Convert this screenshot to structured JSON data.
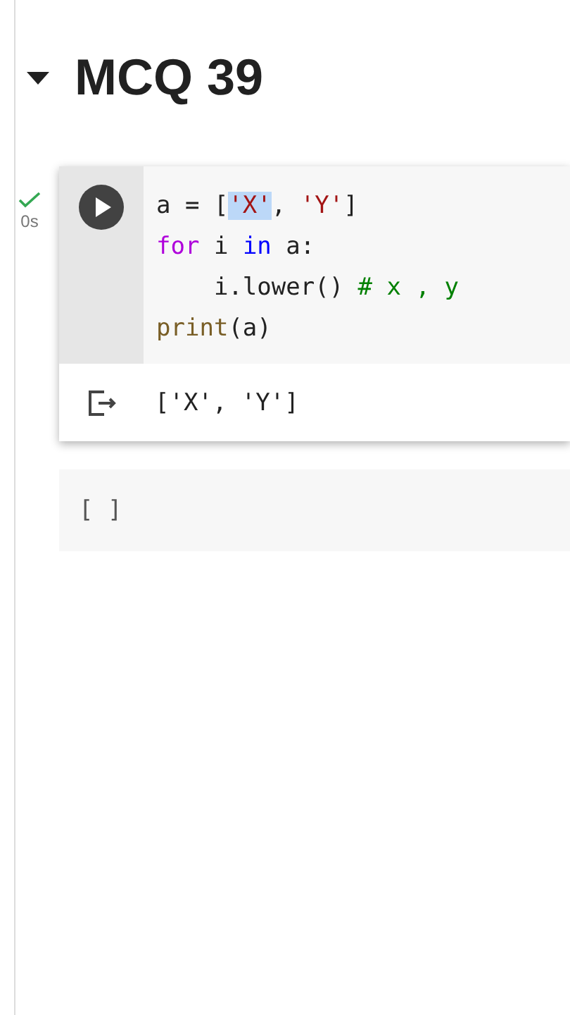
{
  "section": {
    "title": "MCQ 39",
    "expanded": true
  },
  "cells": [
    {
      "kind": "code",
      "succeeded": true,
      "duration": "0s",
      "lines": [
        [
          {
            "text": "a = [",
            "kind": "plain",
            "highlighted": false
          },
          {
            "text": "'X'",
            "kind": "string",
            "highlighted": true
          },
          {
            "text": ", ",
            "kind": "plain",
            "highlighted": false
          },
          {
            "text": "'Y'",
            "kind": "string",
            "highlighted": false
          },
          {
            "text": "]",
            "kind": "plain",
            "highlighted": false
          }
        ],
        [
          {
            "text": "for",
            "kind": "keyword",
            "highlighted": false
          },
          {
            "text": " i ",
            "kind": "plain",
            "highlighted": false
          },
          {
            "text": "in",
            "kind": "operator",
            "highlighted": false
          },
          {
            "text": " a:",
            "kind": "plain",
            "highlighted": false
          }
        ],
        [
          {
            "text": "    i.lower() ",
            "kind": "plain",
            "highlighted": false
          },
          {
            "text": "# x , y",
            "kind": "comment",
            "highlighted": false
          }
        ],
        [
          {
            "text": "print",
            "kind": "builtin",
            "highlighted": false
          },
          {
            "text": "(a)",
            "kind": "plain",
            "highlighted": false
          }
        ]
      ],
      "output": "['X', 'Y']"
    },
    {
      "kind": "empty",
      "prompt": "[ ]"
    }
  ]
}
